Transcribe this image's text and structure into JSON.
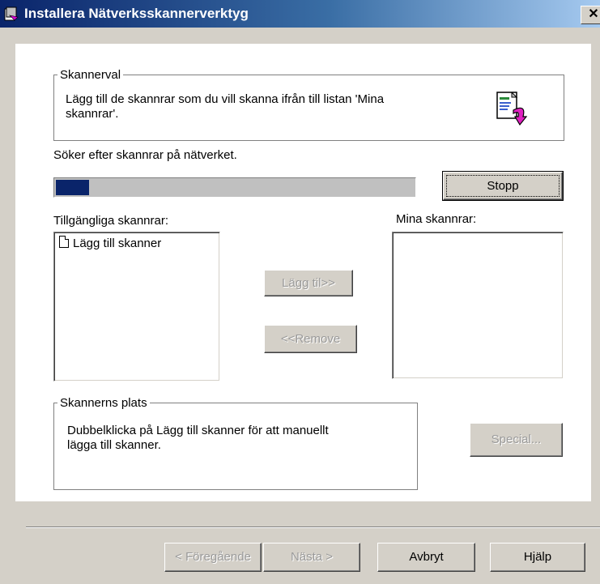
{
  "window": {
    "title": "Installera Nätverksskannerverktyg",
    "close_symbol": "✕",
    "icon": "installer-icon"
  },
  "scanner_selection": {
    "legend": "Skannerval",
    "description_line1": "Lägg till de skannrar som du vill skanna ifrån till listan 'Mina",
    "description_line2": "skannrar'.",
    "icon": "scanner-wizard-icon"
  },
  "search": {
    "status": "Söker efter skannrar på nätverket.",
    "progress_percent": 10,
    "stop_button": "Stopp"
  },
  "available": {
    "label": "Tillgängliga skannrar:",
    "items": [
      {
        "label": "Lägg till skanner",
        "icon": "document-icon"
      }
    ]
  },
  "mine": {
    "label": "Mina skannrar:",
    "items": []
  },
  "actions": {
    "add": "Lägg til>>",
    "remove": "<<Remove"
  },
  "location": {
    "legend": "Skannerns plats",
    "text_line1": "Dubbelklicka på Lägg till skanner för att manuellt",
    "text_line2": "lägga till skanner.",
    "special_button": "Special..."
  },
  "footer": {
    "back": "< Föregående",
    "next": "Nästa >",
    "cancel": "Avbryt",
    "help": "Hjälp"
  }
}
